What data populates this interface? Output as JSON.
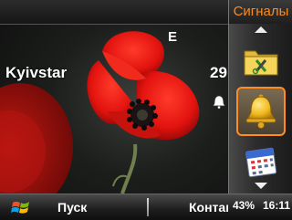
{
  "statusbar": {
    "network_letter": "E",
    "operator": "Kyivstar",
    "date": "29"
  },
  "softkeys": {
    "left_label": "Пуск",
    "right_label": "Контакты",
    "battery": "43%",
    "clock": "16:11"
  },
  "sidebar": {
    "title": "Сигналы",
    "items": [
      {
        "icon": "folder-tools-icon"
      },
      {
        "icon": "bell-icon",
        "selected": true
      },
      {
        "icon": "calendar-icon"
      }
    ]
  },
  "colors": {
    "accent": "#ff8a1a",
    "selection_border": "#ff8c20",
    "text": "#ffffff"
  }
}
